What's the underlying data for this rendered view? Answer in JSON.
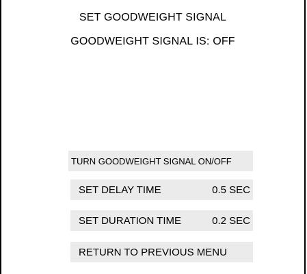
{
  "header": {
    "title": "SET GOODWEIGHT SIGNAL",
    "status": "GOODWEIGHT SIGNAL IS: OFF"
  },
  "menu": {
    "toggle_label": "TURN GOODWEIGHT SIGNAL ON/OFF",
    "delay_label": "SET DELAY TIME",
    "delay_value": "0.5 SEC",
    "duration_label": "SET DURATION TIME",
    "duration_value": "0.2 SEC",
    "return_label": "RETURN TO PREVIOUS MENU"
  },
  "colors": {
    "button_background": "#ebebeb",
    "text": "#000000",
    "background": "#ffffff"
  }
}
